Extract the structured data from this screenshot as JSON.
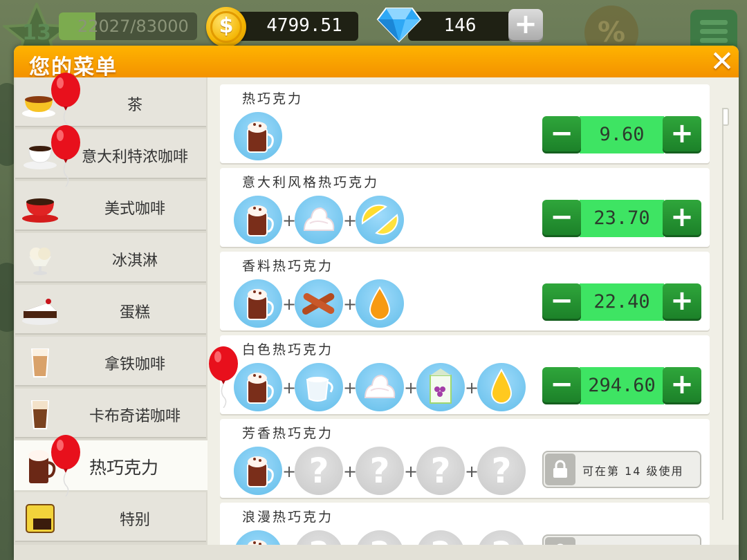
{
  "hud": {
    "level": "13",
    "xp_text": "22027/83000",
    "xp_progress": 0.265,
    "coins": "4799.51",
    "gems": "146",
    "gem_plus": "+",
    "sale_symbol": "%"
  },
  "dialog": {
    "title": "您的菜单",
    "close": "✕"
  },
  "categories": [
    {
      "label": "茶",
      "icon": "tea-cup-icon"
    },
    {
      "label": "意大利特浓咖啡",
      "icon": "espresso-cup-icon"
    },
    {
      "label": "美式咖啡",
      "icon": "americano-cup-icon"
    },
    {
      "label": "冰淇淋",
      "icon": "ice-cream-icon"
    },
    {
      "label": "蛋糕",
      "icon": "cake-icon"
    },
    {
      "label": "拿铁咖啡",
      "icon": "latte-glass-icon"
    },
    {
      "label": "卡布奇诺咖啡",
      "icon": "cappuccino-glass-icon"
    },
    {
      "label": "热巧克力",
      "icon": "hot-chocolate-icon",
      "active": true
    },
    {
      "label": "特别",
      "icon": "special-icon"
    }
  ],
  "recipes": [
    {
      "name": "热巧克力",
      "price": "9.60",
      "ingredients": [
        "hot-chocolate"
      ]
    },
    {
      "name": "意大利风格热巧克力",
      "price": "23.70",
      "ingredients": [
        "hot-chocolate",
        "whipped-cream",
        "lemon"
      ]
    },
    {
      "name": "香料热巧克力",
      "price": "22.40",
      "ingredients": [
        "hot-chocolate",
        "cinnamon",
        "syrup"
      ]
    },
    {
      "name": "白色热巧克力",
      "price": "294.60",
      "ingredients": [
        "hot-chocolate",
        "milk-jug",
        "whipped-cream",
        "grape-juice-carton",
        "honey-drop"
      ]
    },
    {
      "name": "芳香热巧克力",
      "locked_text": "可在第 14 级使用",
      "ingredients": [
        "hot-chocolate",
        "unknown",
        "unknown",
        "unknown",
        "unknown"
      ]
    },
    {
      "name": "浪漫热巧克力",
      "ingredients": [
        "hot-chocolate",
        "unknown",
        "unknown",
        "unknown",
        "unknown"
      ]
    }
  ],
  "symbols": {
    "minus": "−",
    "plus": "+",
    "unknown": "?",
    "join": "+"
  },
  "colors": {
    "header_orange": "#f7a300",
    "price_green": "#3ee463",
    "button_green": "#1f8a2c",
    "ingredient_blue": "#62bde9",
    "balloon_red": "#e8101c"
  }
}
